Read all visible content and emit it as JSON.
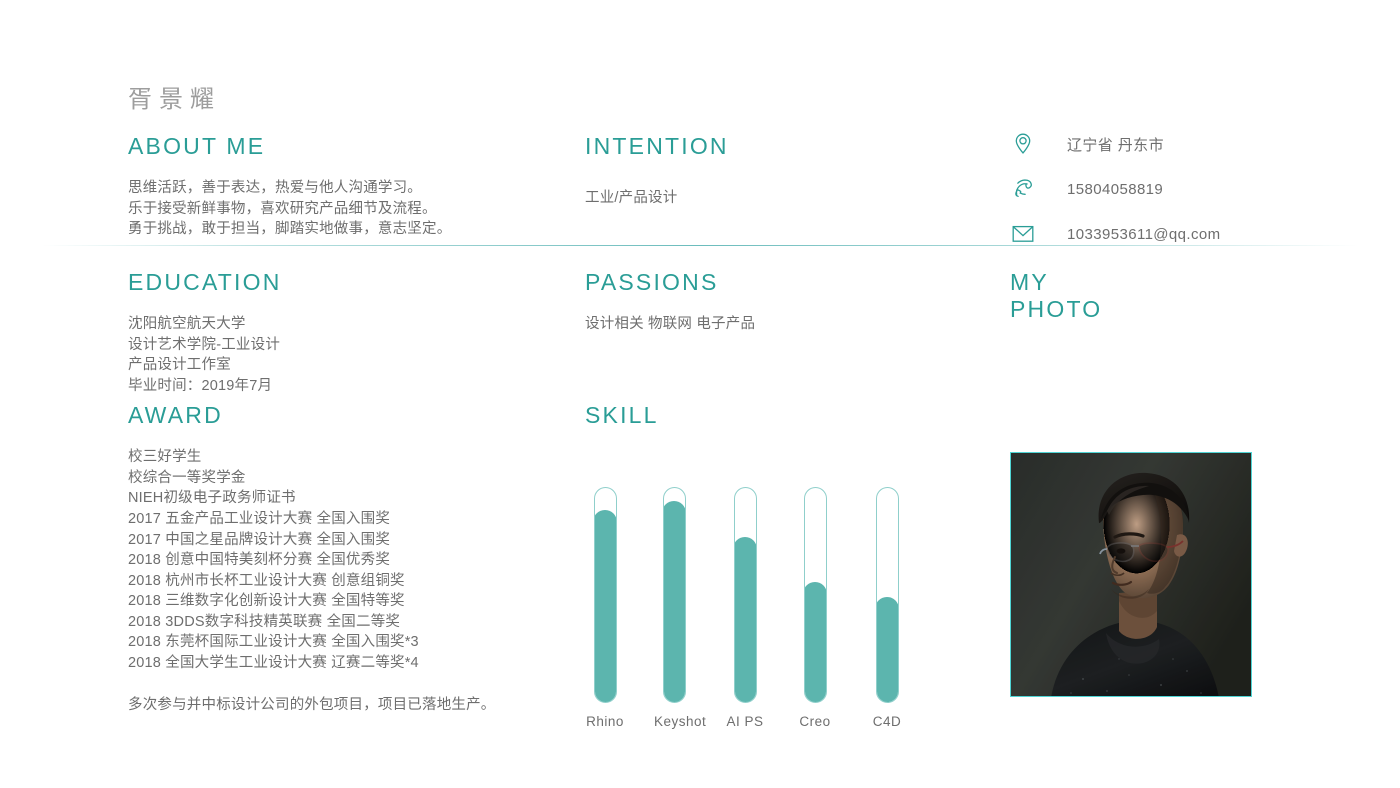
{
  "name": "胥景耀",
  "colors": {
    "accent": "#2a9d96",
    "skill_fill": "#5cb5ae",
    "body_text": "#6e6e6e",
    "photo_border": "#4fd4d4"
  },
  "about": {
    "title": "ABOUT ME",
    "lines": [
      "思维活跃，善于表达，热爱与他人沟通学习。",
      "乐于接受新鲜事物，喜欢研究产品细节及流程。",
      "勇于挑战，敢于担当，脚踏实地做事，意志坚定。"
    ]
  },
  "intention": {
    "title": "INTENTION",
    "lines": [
      "工业/产品设计"
    ]
  },
  "contact": {
    "items": [
      {
        "icon": "location-pin-icon",
        "text": "辽宁省 丹东市"
      },
      {
        "icon": "phone-icon",
        "text": "15804058819"
      },
      {
        "icon": "email-icon",
        "text": "1033953611@qq.com"
      }
    ]
  },
  "education": {
    "title": "EDUCATION",
    "lines": [
      "沈阳航空航天大学",
      "设计艺术学院-工业设计",
      "产品设计工作室",
      "毕业时间：2019年7月"
    ]
  },
  "passions": {
    "title": "PASSIONS",
    "lines": [
      "设计相关 物联网 电子产品"
    ]
  },
  "myphoto": {
    "title": "MY\nPHOTO"
  },
  "award": {
    "title": "AWARD",
    "items": [
      "校三好学生",
      "校综合一等奖学金",
      "NIEH初级电子政务师证书",
      "2017 五金产品工业设计大赛 全国入围奖",
      "2017 中国之星品牌设计大赛 全国入围奖",
      "2018 创意中国特美刻杯分赛 全国优秀奖",
      "2018 杭州市长杯工业设计大赛 创意组铜奖",
      "2018 三维数字化创新设计大赛 全国特等奖",
      "2018 3DDS数字科技精英联赛 全国二等奖",
      "2018 东莞杯国际工业设计大赛 全国入围奖*3",
      "2018 全国大学生工业设计大赛 辽赛二等奖*4"
    ],
    "note": "多次参与并中标设计公司的外包项目，项目已落地生产。"
  },
  "skill": {
    "title": "SKILL",
    "items": [
      {
        "label": "Rhino",
        "percent": 90
      },
      {
        "label": "Keyshot",
        "percent": 94
      },
      {
        "label": "AI PS",
        "percent": 77
      },
      {
        "label": "Creo",
        "percent": 56
      },
      {
        "label": "C4D",
        "percent": 49
      }
    ]
  }
}
